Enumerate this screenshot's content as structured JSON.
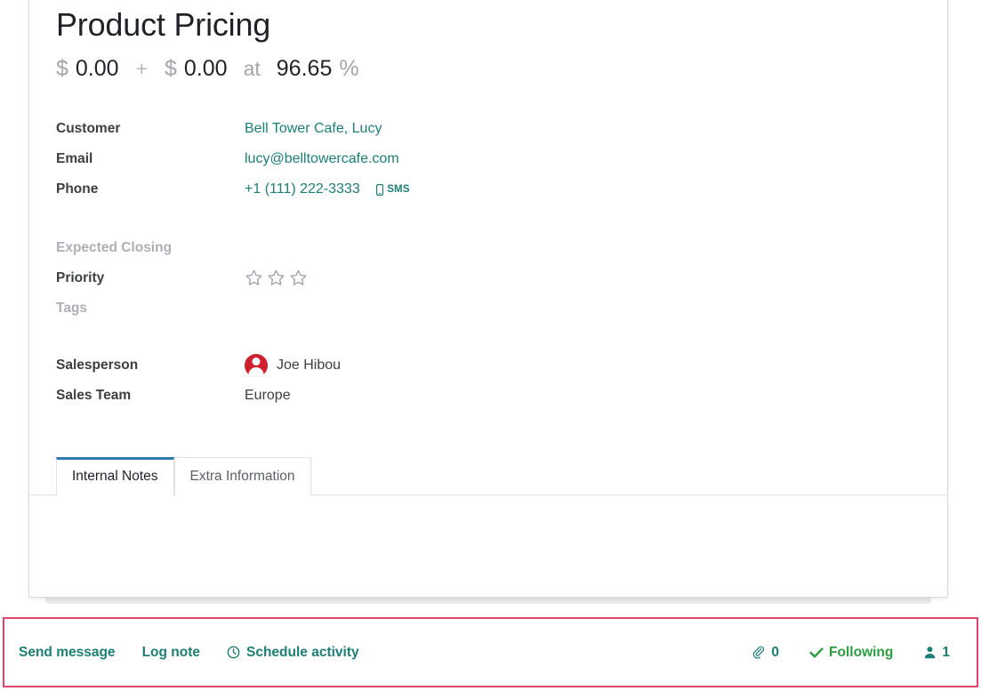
{
  "record": {
    "title": "Product Pricing",
    "price": {
      "currency_symbol": "$",
      "expected_revenue": "0.00",
      "plus_symbol": "+",
      "recurring_revenue": "0.00",
      "at_label": "at",
      "probability": "96.65",
      "percent_symbol": "%"
    },
    "fields": [
      {
        "label": "Customer",
        "value": "Bell Tower Cafe, Lucy"
      },
      {
        "label": "Email",
        "value": "lucy@belltowercafe.com"
      },
      {
        "label": "Phone",
        "value": "+1 (111) 222-3333"
      }
    ],
    "sms_label": "SMS",
    "expected_closing": {
      "label": "Expected Closing",
      "value": ""
    },
    "priority": {
      "label": "Priority",
      "stars_total": 3,
      "stars_filled": 0
    },
    "tags": {
      "label": "Tags",
      "value": ""
    },
    "salesperson": {
      "label": "Salesperson",
      "value": "Joe Hibou"
    },
    "sales_team": {
      "label": "Sales Team",
      "value": "Europe"
    }
  },
  "notebook": {
    "tabs": [
      {
        "label": "Internal Notes",
        "active": true
      },
      {
        "label": "Extra Information",
        "active": false
      }
    ]
  },
  "chatter": {
    "send_message": "Send message",
    "log_note": "Log note",
    "schedule_activity": "Schedule activity",
    "attachment_count": "0",
    "following_label": "Following",
    "follower_count": "1"
  },
  "colors": {
    "link_teal": "#1a7f77",
    "following_green": "#2a9d3f",
    "highlight_red": "#e0456b",
    "active_tab_blue": "#2a7ab0",
    "avatar_red": "#cf2030",
    "muted_gray": "#a3a6ab"
  }
}
